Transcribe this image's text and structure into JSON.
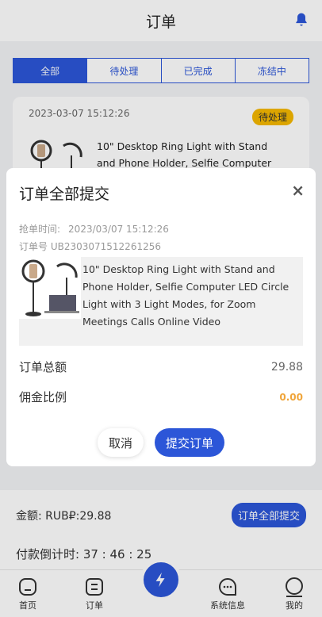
{
  "header": {
    "title": "订单"
  },
  "tabs": [
    {
      "label": "全部",
      "active": true
    },
    {
      "label": "待处理",
      "active": false
    },
    {
      "label": "已完成",
      "active": false
    },
    {
      "label": "冻结中",
      "active": false
    }
  ],
  "order_card": {
    "date": "2023-03-07 15:12:26",
    "status": "待处理",
    "desc": "10\" Desktop Ring Light with Stand and Phone Holder, Selfie Computer LED Circle"
  },
  "bottom": {
    "amount": "金额:  RUB₽:29.88",
    "submit_all": "订单全部提交",
    "countdown": "付款倒计时:  37 : 46 : 25"
  },
  "nav": [
    {
      "label": "首页",
      "icon": "home-icon"
    },
    {
      "label": "订单",
      "icon": "order-icon"
    },
    {
      "label": "",
      "icon": "lightning-icon"
    },
    {
      "label": "系统信息",
      "icon": "chat-icon"
    },
    {
      "label": "我的",
      "icon": "profile-icon"
    }
  ],
  "modal": {
    "title": "订单全部提交",
    "grab_time_label": "抢单时间:",
    "grab_time": "2023/03/07 15:12:26",
    "order_no": "订单号 UB2303071512261256",
    "product_desc": "10\" Desktop Ring Light with Stand and Phone Holder, Selfie Computer LED Circle Light with 3 Light Modes, for Zoom Meetings Calls Online Video",
    "total_label": "订单总额",
    "total_value": "29.88",
    "commission_label": "佣金比例",
    "commission_value": "0.00",
    "cancel_label": "取消",
    "submit_label": "提交订单"
  },
  "colors": {
    "accent": "#2c56d8",
    "badge": "#f5b800",
    "commission": "#f0a53a"
  }
}
